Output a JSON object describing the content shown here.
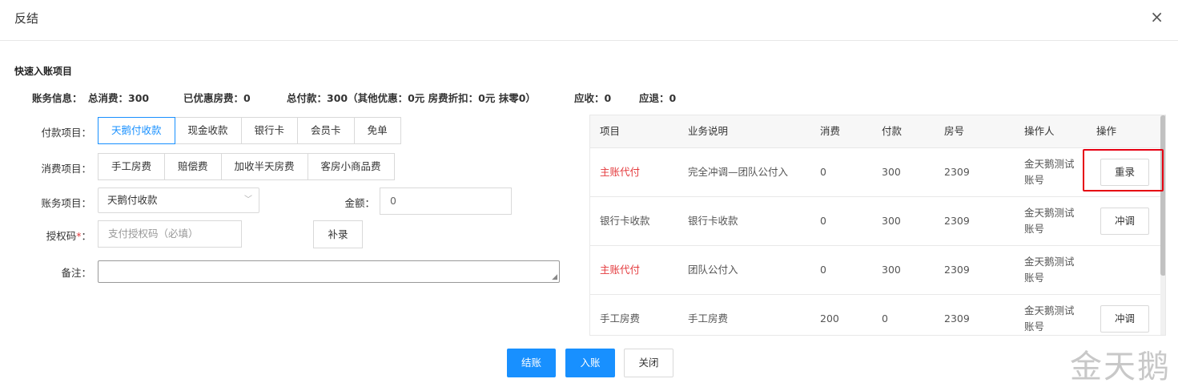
{
  "dialog": {
    "title": "反结",
    "close_icon": "×"
  },
  "section_title": "快速入账项目",
  "account_info": {
    "label": "账务信息：",
    "total_consumption": "总消费：300",
    "room_discount": "已优惠房费：0",
    "total_payment": "总付款：300（其他优惠：0元 房费折扣：0元 抹零0）",
    "receivable": "应收：0",
    "refund": "应退：0"
  },
  "payment_items": {
    "label": "付款项目：",
    "options": [
      "天鹅付收款",
      "现金收款",
      "银行卡",
      "会员卡",
      "免单"
    ],
    "active": "天鹅付收款"
  },
  "consumption_items": {
    "label": "消费项目：",
    "options": [
      "手工房费",
      "赔偿费",
      "加收半天房费",
      "客房小商品费"
    ]
  },
  "account_item": {
    "label": "账务项目：",
    "value": "天鹅付收款"
  },
  "amount": {
    "label": "金额：",
    "value": "0"
  },
  "auth_code": {
    "label": "授权码",
    "required_mark": "*",
    "colon": "：",
    "placeholder": "支付授权码（必填）"
  },
  "supplement_button": "补录",
  "remark": {
    "label": "备注："
  },
  "table": {
    "columns": [
      "项目",
      "业务说明",
      "消费",
      "付款",
      "房号",
      "操作人",
      "操作"
    ],
    "rows": [
      {
        "item": "主账代付",
        "desc": "完全冲调—团队公付入",
        "consume": "0",
        "pay": "300",
        "room": "2309",
        "operator_l1": "金天鹅测试",
        "operator_l2": "账号",
        "action": "重录",
        "red": true
      },
      {
        "item": "银行卡收款",
        "desc": "银行卡收款",
        "consume": "0",
        "pay": "300",
        "room": "2309",
        "operator_l1": "金天鹅测试",
        "operator_l2": "账号",
        "action": "冲调",
        "red": false
      },
      {
        "item": "主账代付",
        "desc": "团队公付入",
        "consume": "0",
        "pay": "300",
        "room": "2309",
        "operator_l1": "金天鹅测试",
        "operator_l2": "账号",
        "action": "",
        "red": true
      },
      {
        "item": "手工房费",
        "desc": "手工房费",
        "consume": "200",
        "pay": "0",
        "room": "2309",
        "operator_l1": "金天鹅测试",
        "operator_l2": "账号",
        "action": "冲调",
        "red": false
      }
    ]
  },
  "footer": {
    "checkout": "结账",
    "post": "入账",
    "close": "关闭"
  },
  "watermark": "金天鹅",
  "colors": {
    "primary": "#1890ff",
    "highlight": "#e60012",
    "red_text": "#e4393c"
  }
}
